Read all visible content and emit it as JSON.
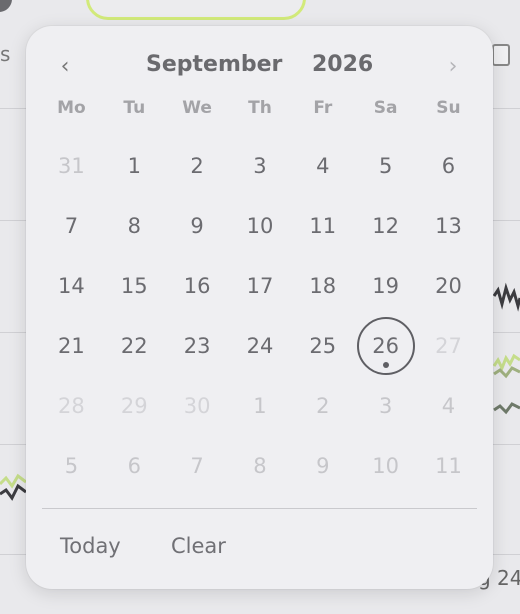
{
  "background": {
    "left_text": "s",
    "axis_fragment": "g 24"
  },
  "calendar": {
    "prev_label": "‹",
    "next_label": "›",
    "month": "September",
    "year": "2026",
    "weekdays": [
      "Mo",
      "Tu",
      "We",
      "Th",
      "Fr",
      "Sa",
      "Su"
    ],
    "days": [
      {
        "label": "31",
        "state": "other"
      },
      {
        "label": "1",
        "state": "current"
      },
      {
        "label": "2",
        "state": "current"
      },
      {
        "label": "3",
        "state": "current"
      },
      {
        "label": "4",
        "state": "current"
      },
      {
        "label": "5",
        "state": "current"
      },
      {
        "label": "6",
        "state": "current"
      },
      {
        "label": "7",
        "state": "current"
      },
      {
        "label": "8",
        "state": "current"
      },
      {
        "label": "9",
        "state": "current"
      },
      {
        "label": "10",
        "state": "current"
      },
      {
        "label": "11",
        "state": "current"
      },
      {
        "label": "12",
        "state": "current"
      },
      {
        "label": "13",
        "state": "current"
      },
      {
        "label": "14",
        "state": "current"
      },
      {
        "label": "15",
        "state": "current"
      },
      {
        "label": "16",
        "state": "current"
      },
      {
        "label": "17",
        "state": "current"
      },
      {
        "label": "18",
        "state": "current"
      },
      {
        "label": "19",
        "state": "current"
      },
      {
        "label": "20",
        "state": "current"
      },
      {
        "label": "21",
        "state": "current"
      },
      {
        "label": "22",
        "state": "current"
      },
      {
        "label": "23",
        "state": "current"
      },
      {
        "label": "24",
        "state": "current"
      },
      {
        "label": "25",
        "state": "current"
      },
      {
        "label": "26",
        "state": "selected"
      },
      {
        "label": "27",
        "state": "muted"
      },
      {
        "label": "28",
        "state": "muted"
      },
      {
        "label": "29",
        "state": "muted"
      },
      {
        "label": "30",
        "state": "muted"
      },
      {
        "label": "1",
        "state": "other"
      },
      {
        "label": "2",
        "state": "other"
      },
      {
        "label": "3",
        "state": "other"
      },
      {
        "label": "4",
        "state": "other"
      },
      {
        "label": "5",
        "state": "other"
      },
      {
        "label": "6",
        "state": "other"
      },
      {
        "label": "7",
        "state": "other"
      },
      {
        "label": "8",
        "state": "other"
      },
      {
        "label": "9",
        "state": "other"
      },
      {
        "label": "10",
        "state": "other"
      },
      {
        "label": "11",
        "state": "other"
      }
    ],
    "today_label": "Today",
    "clear_label": "Clear"
  },
  "colors": {
    "accent_pill": "#d2ea7a",
    "selected_ring": "#5f5f64"
  }
}
